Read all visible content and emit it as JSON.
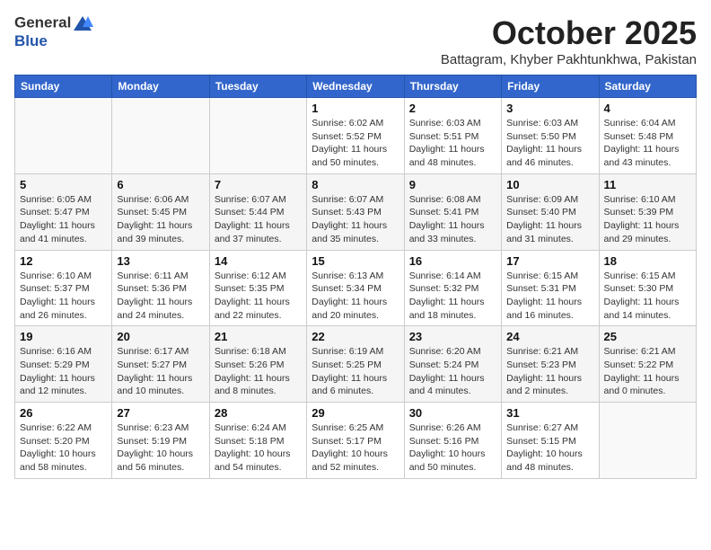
{
  "header": {
    "logo_line1": "General",
    "logo_line2": "Blue",
    "month": "October 2025",
    "location": "Battagram, Khyber Pakhtunkhwa, Pakistan"
  },
  "weekdays": [
    "Sunday",
    "Monday",
    "Tuesday",
    "Wednesday",
    "Thursday",
    "Friday",
    "Saturday"
  ],
  "weeks": [
    [
      {
        "day": "",
        "info": ""
      },
      {
        "day": "",
        "info": ""
      },
      {
        "day": "",
        "info": ""
      },
      {
        "day": "1",
        "info": "Sunrise: 6:02 AM\nSunset: 5:52 PM\nDaylight: 11 hours and 50 minutes."
      },
      {
        "day": "2",
        "info": "Sunrise: 6:03 AM\nSunset: 5:51 PM\nDaylight: 11 hours and 48 minutes."
      },
      {
        "day": "3",
        "info": "Sunrise: 6:03 AM\nSunset: 5:50 PM\nDaylight: 11 hours and 46 minutes."
      },
      {
        "day": "4",
        "info": "Sunrise: 6:04 AM\nSunset: 5:48 PM\nDaylight: 11 hours and 43 minutes."
      }
    ],
    [
      {
        "day": "5",
        "info": "Sunrise: 6:05 AM\nSunset: 5:47 PM\nDaylight: 11 hours and 41 minutes."
      },
      {
        "day": "6",
        "info": "Sunrise: 6:06 AM\nSunset: 5:45 PM\nDaylight: 11 hours and 39 minutes."
      },
      {
        "day": "7",
        "info": "Sunrise: 6:07 AM\nSunset: 5:44 PM\nDaylight: 11 hours and 37 minutes."
      },
      {
        "day": "8",
        "info": "Sunrise: 6:07 AM\nSunset: 5:43 PM\nDaylight: 11 hours and 35 minutes."
      },
      {
        "day": "9",
        "info": "Sunrise: 6:08 AM\nSunset: 5:41 PM\nDaylight: 11 hours and 33 minutes."
      },
      {
        "day": "10",
        "info": "Sunrise: 6:09 AM\nSunset: 5:40 PM\nDaylight: 11 hours and 31 minutes."
      },
      {
        "day": "11",
        "info": "Sunrise: 6:10 AM\nSunset: 5:39 PM\nDaylight: 11 hours and 29 minutes."
      }
    ],
    [
      {
        "day": "12",
        "info": "Sunrise: 6:10 AM\nSunset: 5:37 PM\nDaylight: 11 hours and 26 minutes."
      },
      {
        "day": "13",
        "info": "Sunrise: 6:11 AM\nSunset: 5:36 PM\nDaylight: 11 hours and 24 minutes."
      },
      {
        "day": "14",
        "info": "Sunrise: 6:12 AM\nSunset: 5:35 PM\nDaylight: 11 hours and 22 minutes."
      },
      {
        "day": "15",
        "info": "Sunrise: 6:13 AM\nSunset: 5:34 PM\nDaylight: 11 hours and 20 minutes."
      },
      {
        "day": "16",
        "info": "Sunrise: 6:14 AM\nSunset: 5:32 PM\nDaylight: 11 hours and 18 minutes."
      },
      {
        "day": "17",
        "info": "Sunrise: 6:15 AM\nSunset: 5:31 PM\nDaylight: 11 hours and 16 minutes."
      },
      {
        "day": "18",
        "info": "Sunrise: 6:15 AM\nSunset: 5:30 PM\nDaylight: 11 hours and 14 minutes."
      }
    ],
    [
      {
        "day": "19",
        "info": "Sunrise: 6:16 AM\nSunset: 5:29 PM\nDaylight: 11 hours and 12 minutes."
      },
      {
        "day": "20",
        "info": "Sunrise: 6:17 AM\nSunset: 5:27 PM\nDaylight: 11 hours and 10 minutes."
      },
      {
        "day": "21",
        "info": "Sunrise: 6:18 AM\nSunset: 5:26 PM\nDaylight: 11 hours and 8 minutes."
      },
      {
        "day": "22",
        "info": "Sunrise: 6:19 AM\nSunset: 5:25 PM\nDaylight: 11 hours and 6 minutes."
      },
      {
        "day": "23",
        "info": "Sunrise: 6:20 AM\nSunset: 5:24 PM\nDaylight: 11 hours and 4 minutes."
      },
      {
        "day": "24",
        "info": "Sunrise: 6:21 AM\nSunset: 5:23 PM\nDaylight: 11 hours and 2 minutes."
      },
      {
        "day": "25",
        "info": "Sunrise: 6:21 AM\nSunset: 5:22 PM\nDaylight: 11 hours and 0 minutes."
      }
    ],
    [
      {
        "day": "26",
        "info": "Sunrise: 6:22 AM\nSunset: 5:20 PM\nDaylight: 10 hours and 58 minutes."
      },
      {
        "day": "27",
        "info": "Sunrise: 6:23 AM\nSunset: 5:19 PM\nDaylight: 10 hours and 56 minutes."
      },
      {
        "day": "28",
        "info": "Sunrise: 6:24 AM\nSunset: 5:18 PM\nDaylight: 10 hours and 54 minutes."
      },
      {
        "day": "29",
        "info": "Sunrise: 6:25 AM\nSunset: 5:17 PM\nDaylight: 10 hours and 52 minutes."
      },
      {
        "day": "30",
        "info": "Sunrise: 6:26 AM\nSunset: 5:16 PM\nDaylight: 10 hours and 50 minutes."
      },
      {
        "day": "31",
        "info": "Sunrise: 6:27 AM\nSunset: 5:15 PM\nDaylight: 10 hours and 48 minutes."
      },
      {
        "day": "",
        "info": ""
      }
    ]
  ]
}
